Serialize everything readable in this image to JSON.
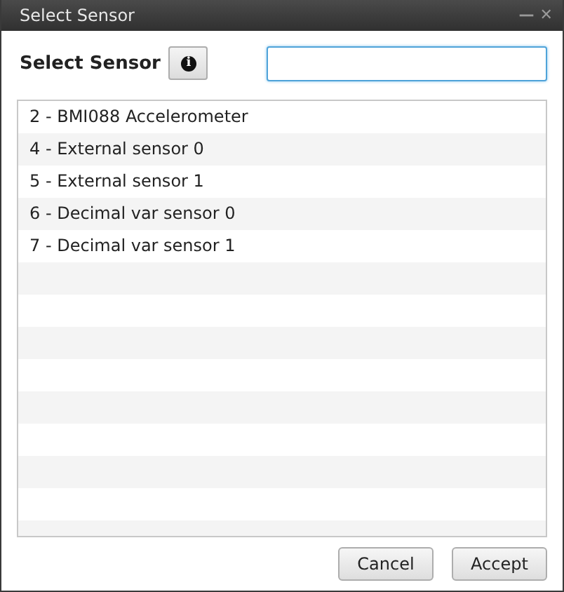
{
  "window": {
    "title": "Select Sensor",
    "controls": [
      "—",
      "✕"
    ]
  },
  "header": {
    "label": "Select Sensor",
    "info_button": "i"
  },
  "sensors": [
    {
      "label": "2 - BMI088 Accelerometer"
    },
    {
      "label": "4 - External sensor 0"
    },
    {
      "label": "5 - External sensor 1"
    },
    {
      "label": "6 - Decimal var sensor 0"
    },
    {
      "label": "7 - Decimal var sensor 1"
    }
  ],
  "buttons": [
    "Cancel",
    "Accept"
  ]
}
